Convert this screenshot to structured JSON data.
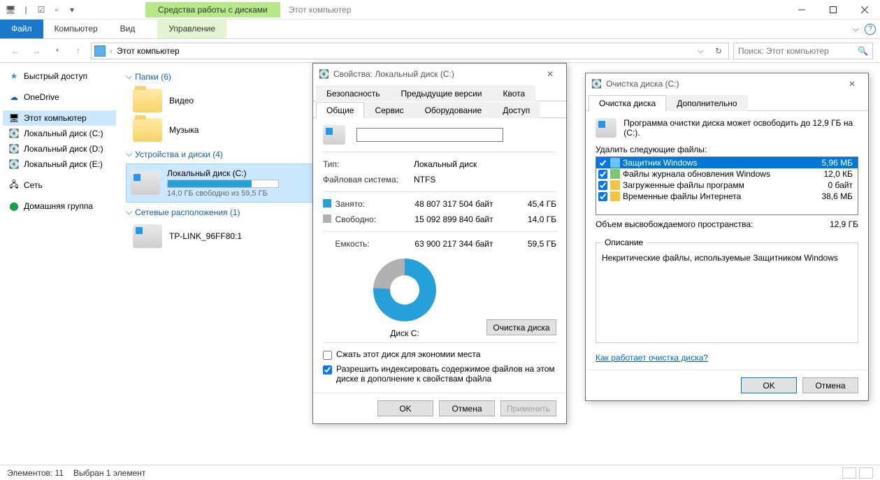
{
  "titlebar": {
    "contextTab": "Средства работы с дисками",
    "title": "Этот компьютер"
  },
  "ribbon": {
    "file": "Файл",
    "computer": "Компьютер",
    "view": "Вид",
    "manage": "Управление"
  },
  "nav": {
    "breadcrumb": "Этот компьютер",
    "searchPlaceholder": "Поиск: Этот компьютер"
  },
  "sidebar": {
    "items": [
      {
        "label": "Быстрый доступ"
      },
      {
        "label": "OneDrive"
      },
      {
        "label": "Этот компьютер"
      },
      {
        "label": "Локальный диск (C:)"
      },
      {
        "label": "Локальный диск (D:)"
      },
      {
        "label": "Локальный диск (E:)"
      },
      {
        "label": "Сеть"
      },
      {
        "label": "Домашняя группа"
      }
    ]
  },
  "groups": {
    "folders": "Папки (6)",
    "devices": "Устройства и диски (4)",
    "network": "Сетевые расположения (1)"
  },
  "folders": {
    "video": "Видео",
    "music": "Музыка"
  },
  "drive": {
    "name": "Локальный диск (C:)",
    "sub": "14,0 ГБ свободно из 59,5 ГБ",
    "fillPct": 76
  },
  "netloc": {
    "name": "TP-LINK_96FF80:1"
  },
  "status": {
    "count": "Элементов: 11",
    "selected": "Выбран 1 элемент"
  },
  "propsDialog": {
    "title": "Свойства: Локальный диск (C:)",
    "tabs": {
      "security": "Безопасность",
      "prev": "Предыдущие версии",
      "quota": "Квота",
      "general": "Общие",
      "service": "Сервис",
      "hardware": "Оборудование",
      "access": "Доступ"
    },
    "typeLabel": "Тип:",
    "typeVal": "Локальный диск",
    "fsLabel": "Файловая система:",
    "fsVal": "NTFS",
    "usedLabel": "Занято:",
    "usedBytes": "48 807 317 504 байт",
    "usedSize": "45,4 ГБ",
    "freeLabel": "Свободно:",
    "freeBytes": "15 092 899 840 байт",
    "freeSize": "14,0 ГБ",
    "capLabel": "Емкость:",
    "capBytes": "63 900 217 344 байт",
    "capSize": "59,5 ГБ",
    "diskLabel": "Диск C:",
    "cleanupBtn": "Очистка диска",
    "compress": "Сжать этот диск для экономии места",
    "index": "Разрешить индексировать содержимое файлов на этом диске в дополнение к свойствам файла",
    "ok": "OK",
    "cancel": "Отмена",
    "apply": "Применить"
  },
  "cleanupDialog": {
    "title": "Очистка диска  (C:)",
    "tabCleanup": "Очистка диска",
    "tabMore": "Дополнительно",
    "intro": "Программа очистки диска может освободить до 12,9 ГБ на  (C:).",
    "deleteLabel": "Удалить следующие файлы:",
    "items": [
      {
        "label": "Защитник Windows",
        "size": "5,96 МБ",
        "checked": true,
        "selected": true
      },
      {
        "label": "Файлы журнала обновления Windows",
        "size": "12,0 КБ",
        "checked": true
      },
      {
        "label": "Загруженные файлы программ",
        "size": "0 байт",
        "checked": true
      },
      {
        "label": "Временные файлы Интернета",
        "size": "38,6 МБ",
        "checked": true
      }
    ],
    "freedLabel": "Объем высвобождаемого пространства:",
    "freedSize": "12,9 ГБ",
    "descLegend": "Описание",
    "descText": "Некритические файлы, используемые Защитником Windows",
    "helpLink": "Как работает очистка диска?",
    "ok": "OK",
    "cancel": "Отмена"
  }
}
